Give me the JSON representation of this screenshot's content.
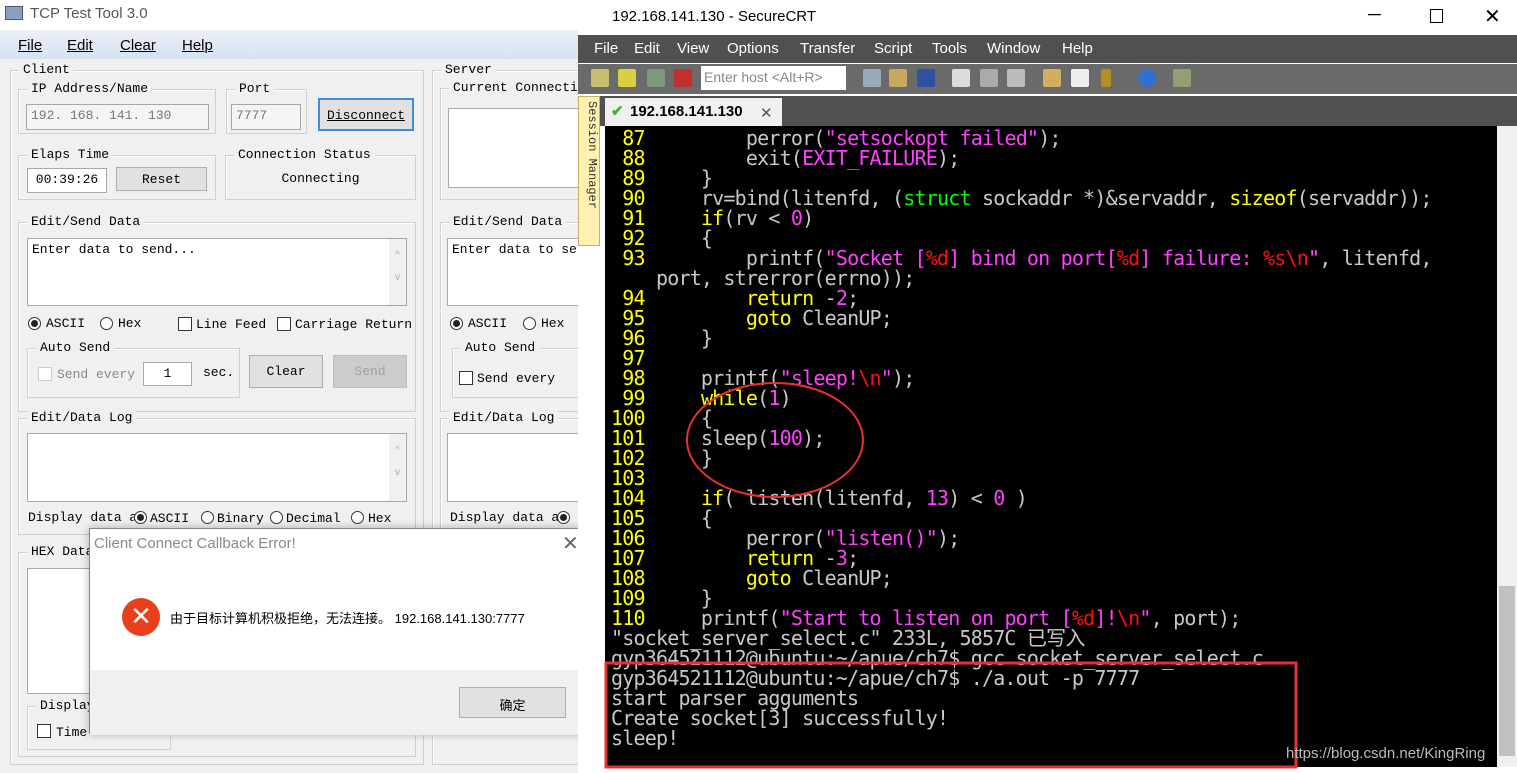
{
  "tcp_tool": {
    "title": "TCP Test Tool 3.0",
    "menu": [
      "File",
      "Edit",
      "Clear",
      "Help"
    ],
    "client": {
      "label": "Client",
      "ip_label": "IP Address/Name",
      "ip_value": "192. 168. 141. 130",
      "port_label": "Port",
      "port_value": "7777",
      "disconnect": "Disconnect",
      "elaps_label": "Elaps Time",
      "elaps_value": "00:39:26",
      "reset": "Reset",
      "status_label": "Connection Status",
      "status_value": "Connecting",
      "send_label": "Edit/Send Data",
      "send_placeholder": "Enter data to send...",
      "ascii": "ASCII",
      "hex": "Hex",
      "line_feed": "Line Feed",
      "carriage_return": "Carriage Return",
      "auto_send_label": "Auto Send",
      "send_every": "Send every",
      "interval": "1",
      "sec": "sec.",
      "clear": "Clear",
      "send": "Send",
      "log_label": "Edit/Data Log",
      "display_as": "Display data a",
      "binary": "Binary",
      "decimal": "Decimal",
      "hex_data_label": "HEX Data",
      "display_label": "Display",
      "time": "Time"
    },
    "server": {
      "label": "Server",
      "conn_label": "Current Connectio",
      "send_label": "Edit/Send Data",
      "send_placeholder": "Enter data to sen",
      "ascii": "ASCII",
      "hex": "Hex",
      "auto_send_label": "Auto Send",
      "send_every": "Send every",
      "log_label": "Edit/Data Log",
      "display_as": "Display data a"
    }
  },
  "dialog": {
    "title": "Client Connect Callback Error!",
    "message": "由于目标计算机积极拒绝，无法连接。 192.168.141.130:7777",
    "ok": "确定",
    "icon": "error-icon",
    "icon_color": "#e8401c"
  },
  "securecrt": {
    "title": "192.168.141.130 - SecureCRT",
    "menu": [
      "File",
      "Edit",
      "View",
      "Options",
      "Transfer",
      "Script",
      "Tools",
      "Window",
      "Help"
    ],
    "host_placeholder": "Enter host <Alt+R>",
    "tab": "192.168.141.130",
    "session_manager": "Session Manager",
    "watermark": "https://blog.csdn.net/KingRing",
    "code_lines": [
      {
        "num": "87",
        "segs": [
          [
            "        perror(",
            "n"
          ],
          [
            "\"setsockopt failed\"",
            "s"
          ],
          [
            ");",
            "n"
          ]
        ]
      },
      {
        "num": "88",
        "segs": [
          [
            "        exit(",
            "n"
          ],
          [
            "EXIT_FAILURE",
            "s"
          ],
          [
            ");",
            "n"
          ]
        ]
      },
      {
        "num": "89",
        "segs": [
          [
            "    }",
            "n"
          ]
        ]
      },
      {
        "num": "90",
        "segs": [
          [
            "    rv=bind(litenfd, (",
            "n"
          ],
          [
            "struct",
            "g"
          ],
          [
            " sockaddr *)&servaddr, ",
            "n"
          ],
          [
            "sizeof",
            "y"
          ],
          [
            "(servaddr));",
            "n"
          ]
        ]
      },
      {
        "num": "91",
        "segs": [
          [
            "    ",
            "n"
          ],
          [
            "if",
            "y"
          ],
          [
            "(rv < ",
            "n"
          ],
          [
            "0",
            "s"
          ],
          [
            ")",
            "n"
          ]
        ]
      },
      {
        "num": "92",
        "segs": [
          [
            "    {",
            "n"
          ]
        ]
      },
      {
        "num": "93",
        "segs": [
          [
            "        printf(",
            "n"
          ],
          [
            "\"Socket [",
            "s"
          ],
          [
            "%d",
            "r"
          ],
          [
            "] bind on port[",
            "s"
          ],
          [
            "%d",
            "r"
          ],
          [
            "] failure: ",
            "s"
          ],
          [
            "%s\\n",
            "r"
          ],
          [
            "\"",
            "s"
          ],
          [
            ", litenfd,",
            "n"
          ]
        ]
      },
      {
        "num": "",
        "segs": [
          [
            "port, strerror(errno));",
            "n"
          ]
        ]
      },
      {
        "num": "94",
        "segs": [
          [
            "        ",
            "n"
          ],
          [
            "return",
            "y"
          ],
          [
            " -",
            "n"
          ],
          [
            "2",
            "s"
          ],
          [
            ";",
            "n"
          ]
        ]
      },
      {
        "num": "95",
        "segs": [
          [
            "        ",
            "n"
          ],
          [
            "goto",
            "y"
          ],
          [
            " CleanUP;",
            "n"
          ]
        ]
      },
      {
        "num": "96",
        "segs": [
          [
            "    }",
            "n"
          ]
        ]
      },
      {
        "num": "97",
        "segs": []
      },
      {
        "num": "98",
        "segs": [
          [
            "    printf(",
            "n"
          ],
          [
            "\"sleep!",
            "s"
          ],
          [
            "\\n",
            "r"
          ],
          [
            "\"",
            "s"
          ],
          [
            ");",
            "n"
          ]
        ]
      },
      {
        "num": "99",
        "segs": [
          [
            "    ",
            "n"
          ],
          [
            "while",
            "y"
          ],
          [
            "(",
            "n"
          ],
          [
            "1",
            "s"
          ],
          [
            ")",
            "n"
          ]
        ]
      },
      {
        "num": "100",
        "segs": [
          [
            "    {",
            "n"
          ]
        ]
      },
      {
        "num": "101",
        "segs": [
          [
            "    sleep(",
            "n"
          ],
          [
            "100",
            "s"
          ],
          [
            ");",
            "n"
          ]
        ]
      },
      {
        "num": "102",
        "segs": [
          [
            "    }",
            "n"
          ]
        ]
      },
      {
        "num": "103",
        "segs": []
      },
      {
        "num": "104",
        "segs": [
          [
            "    ",
            "n"
          ],
          [
            "if",
            "y"
          ],
          [
            "( listen(litenfd, ",
            "n"
          ],
          [
            "13",
            "s"
          ],
          [
            ") < ",
            "n"
          ],
          [
            "0",
            "s"
          ],
          [
            " )",
            "n"
          ]
        ]
      },
      {
        "num": "105",
        "segs": [
          [
            "    {",
            "n"
          ]
        ]
      },
      {
        "num": "106",
        "segs": [
          [
            "        perror(",
            "n"
          ],
          [
            "\"listen()\"",
            "s"
          ],
          [
            ");",
            "n"
          ]
        ]
      },
      {
        "num": "107",
        "segs": [
          [
            "        ",
            "n"
          ],
          [
            "return",
            "y"
          ],
          [
            " -",
            "n"
          ],
          [
            "3",
            "s"
          ],
          [
            ";",
            "n"
          ]
        ]
      },
      {
        "num": "108",
        "segs": [
          [
            "        ",
            "n"
          ],
          [
            "goto",
            "y"
          ],
          [
            " CleanUP;",
            "n"
          ]
        ]
      },
      {
        "num": "109",
        "segs": [
          [
            "    }",
            "n"
          ]
        ]
      },
      {
        "num": "110",
        "segs": [
          [
            "    printf(",
            "n"
          ],
          [
            "\"Start to listen on port [",
            "s"
          ],
          [
            "%d",
            "r"
          ],
          [
            "]!",
            "s"
          ],
          [
            "\\n",
            "r"
          ],
          [
            "\"",
            "s"
          ],
          [
            ", port);",
            "n"
          ]
        ]
      }
    ],
    "output_lines": [
      "\"socket_server_select.c\" 233L, 5857C 已写入",
      "gyp364521112@ubuntu:~/apue/ch7$ gcc socket_server_select.c",
      "gyp364521112@ubuntu:~/apue/ch7$ ./a.out -p 7777",
      "start parser agguments",
      "Create socket[3] successfully!",
      "sleep!"
    ],
    "annotation_color": "#e83030"
  }
}
